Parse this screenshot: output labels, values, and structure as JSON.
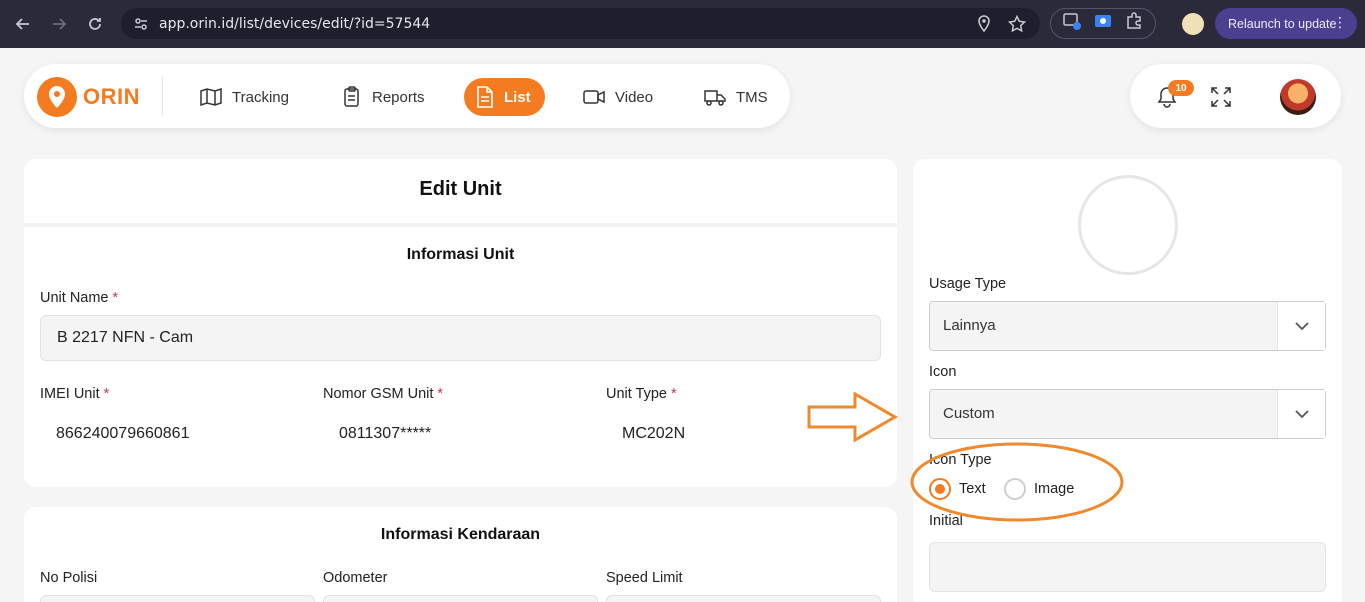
{
  "browser": {
    "url": "app.orin.id/list/devices/edit/?id=57544",
    "relaunch_label": "Relaunch to update"
  },
  "app": {
    "brand": "ORIN",
    "nav": [
      {
        "label": "Tracking",
        "icon": "map-icon"
      },
      {
        "label": "Reports",
        "icon": "clipboard-icon"
      },
      {
        "label": "List",
        "icon": "document-icon",
        "active": true
      },
      {
        "label": "Video",
        "icon": "video-icon"
      },
      {
        "label": "TMS",
        "icon": "truck-icon"
      }
    ],
    "notifications_count": "10",
    "accent_color": "#f47b20"
  },
  "form": {
    "title": "Edit Unit",
    "unit_section": "Informasi Unit",
    "unit_name_label": "Unit Name",
    "unit_name_value": "B 2217 NFN - Cam",
    "imei_label": "IMEI Unit",
    "imei_value": "866240079660861",
    "gsm_label": "Nomor GSM Unit",
    "gsm_value": "0811307*****",
    "unit_type_label": "Unit Type",
    "unit_type_value": "MC202N",
    "required_mark": "*",
    "vehicle_section": "Informasi Kendaraan",
    "no_polisi_label": "No Polisi",
    "odometer_label": "Odometer",
    "speed_limit_label": "Speed Limit"
  },
  "side": {
    "usage_type_label": "Usage Type",
    "usage_type_value": "Lainnya",
    "icon_label": "Icon",
    "icon_value": "Custom",
    "icon_type_label": "Icon Type",
    "icon_type_options": [
      "Text",
      "Image"
    ],
    "icon_type_selected": "Text",
    "initial_label": "Initial",
    "initial_value": ""
  }
}
